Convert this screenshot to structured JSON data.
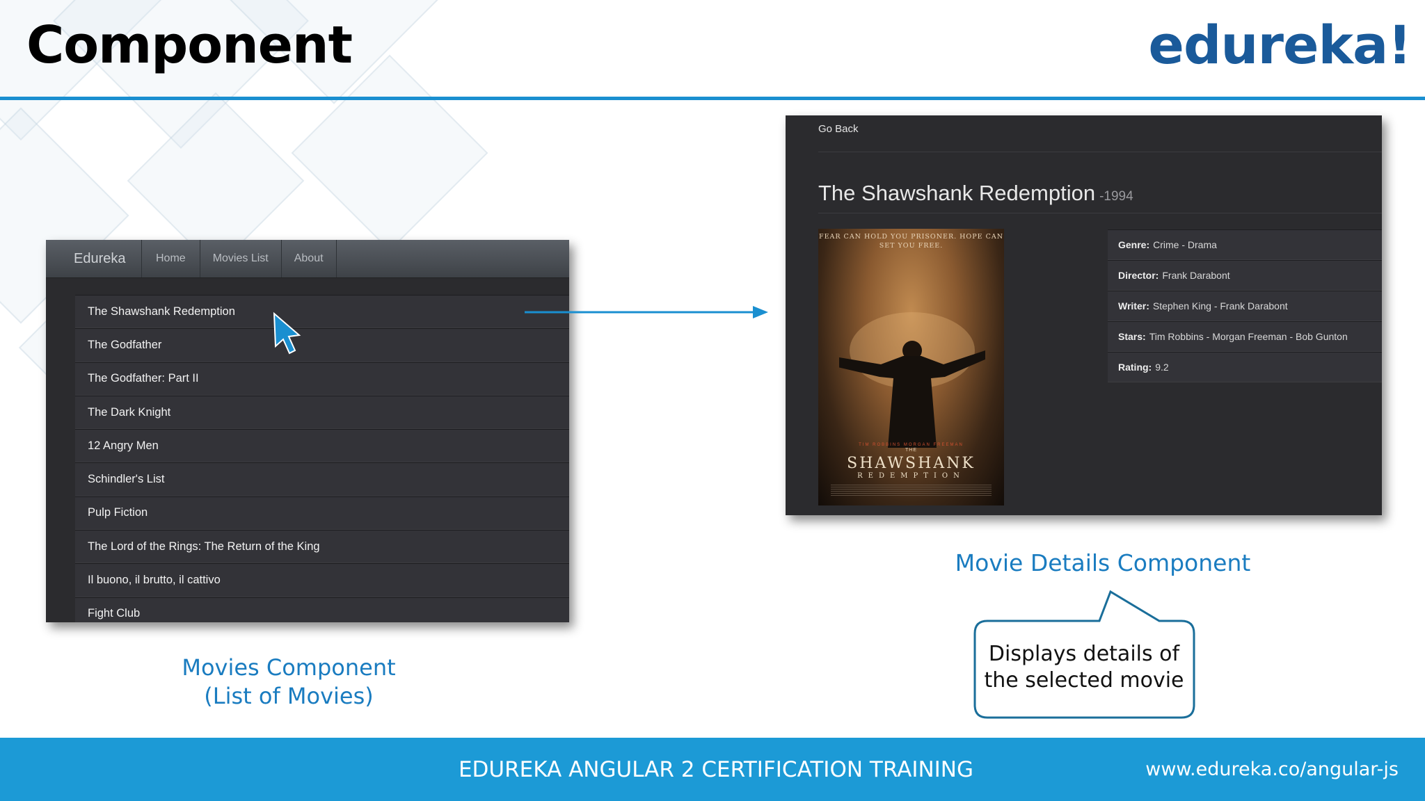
{
  "slide": {
    "title": "Component",
    "logo": "edureka!"
  },
  "movies_app": {
    "brand": "Edureka",
    "nav": [
      "Home",
      "Movies List",
      "About"
    ],
    "movies": [
      "The Shawshank Redemption",
      "The Godfather",
      "The Godfather: Part II",
      "The Dark Knight",
      "12 Angry Men",
      "Schindler's List",
      "Pulp Fiction",
      "The Lord of the Rings: The Return of the King",
      "Il buono, il brutto, il cattivo",
      "Fight Club"
    ]
  },
  "details_app": {
    "go_back": "Go Back",
    "title": "The Shawshank Redemption",
    "year": "-1994",
    "poster": {
      "tagline": "Fear can hold you prisoner. Hope can set you free.",
      "credits": "TIM ROBBINS   MORGAN FREEMAN",
      "the": "THE",
      "title": "SHAWSHANK",
      "subtitle": "REDEMPTION"
    },
    "info": [
      {
        "label": "Genre:",
        "value": "Crime - Drama"
      },
      {
        "label": "Director:",
        "value": "Frank Darabont"
      },
      {
        "label": "Writer:",
        "value": "Stephen King - Frank Darabont"
      },
      {
        "label": "Stars:",
        "value": "Tim Robbins - Morgan Freeman - Bob Gunton"
      },
      {
        "label": "Rating:",
        "value": "9.2"
      }
    ]
  },
  "captions": {
    "movies_line1": "Movies Component",
    "movies_line2": "(List of Movies)",
    "details": "Movie Details Component",
    "callout_line1": "Displays details of",
    "callout_line2": "the selected movie"
  },
  "footer": {
    "center": "EDUREKA ANGULAR 2 CERTIFICATION TRAINING",
    "url": "www.edureka.co/angular-js"
  },
  "colors": {
    "accent_blue": "#1c9ad6",
    "logo_blue": "#1a5a9a",
    "caption_blue": "#1a7cc0",
    "app_dark": "#2b2b2e"
  }
}
